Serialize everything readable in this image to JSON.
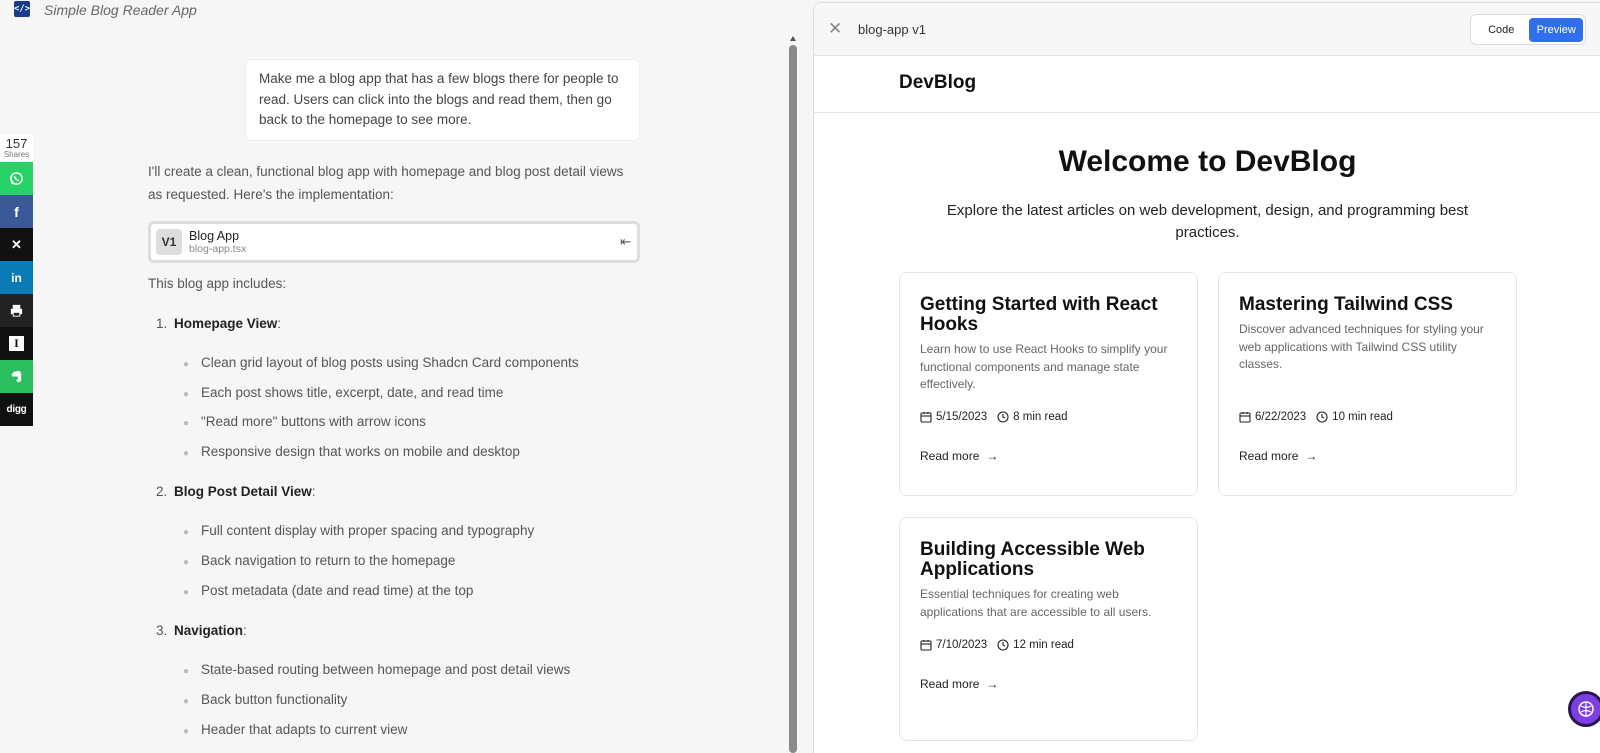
{
  "app": {
    "title": "Simple Blog Reader App",
    "logo_glyph": "</>"
  },
  "share": {
    "count": "157",
    "count_label": "Shares",
    "buttons": [
      {
        "name": "whatsapp",
        "color": "#25d366",
        "glyph": "✆"
      },
      {
        "name": "facebook",
        "color": "#3b5998",
        "glyph": "f"
      },
      {
        "name": "x",
        "color": "#111111",
        "glyph": "𝕏"
      },
      {
        "name": "linkedin",
        "color": "#0a7bb5",
        "glyph": "in"
      },
      {
        "name": "print",
        "color": "#222222",
        "glyph": "⎙"
      },
      {
        "name": "instapaper",
        "color": "#111111",
        "glyph": "I"
      },
      {
        "name": "evernote",
        "color": "#2dbe60",
        "glyph": "❦"
      },
      {
        "name": "digg",
        "color": "#111111",
        "glyph": "digg"
      }
    ]
  },
  "chat": {
    "user_message": "Make me a blog app that has a few blogs there for people to read. Users can click into the blogs and read them, then go back to the homepage to see more.",
    "intro": "I'll create a clean, functional blog app with homepage and blog post detail views as requested. Here's the implementation:",
    "artifact": {
      "version": "V1",
      "name": "Blog App",
      "file": "blog-app.tsx"
    },
    "includes_label": "This blog app includes:",
    "sections": [
      {
        "number": "1.",
        "title": "Homepage View",
        "bullets": [
          "Clean grid layout of blog posts using Shadcn Card components",
          "Each post shows title, excerpt, date, and read time",
          "\"Read more\" buttons with arrow icons",
          "Responsive design that works on mobile and desktop"
        ]
      },
      {
        "number": "2.",
        "title": "Blog Post Detail View",
        "bullets": [
          "Full content display with proper spacing and typography",
          "Back navigation to return to the homepage",
          "Post metadata (date and read time) at the top"
        ]
      },
      {
        "number": "3.",
        "title": "Navigation",
        "bullets": [
          "State-based routing between homepage and post detail views",
          "Back button functionality",
          "Header that adapts to current view"
        ]
      }
    ]
  },
  "panel": {
    "title": "blog-app v1",
    "code_label": "Code",
    "preview_label": "Preview",
    "accent": "#2f6fed"
  },
  "preview": {
    "brand": "DevBlog",
    "hero_title": "Welcome to DevBlog",
    "hero_subtitle": "Explore the latest articles on web development, design, and programming best practices.",
    "posts": [
      {
        "title": "Getting Started with React Hooks",
        "excerpt": "Learn how to use React Hooks to simplify your functional components and manage state effectively.",
        "date": "5/15/2023",
        "read_time": "8 min read",
        "cta": "Read more"
      },
      {
        "title": "Mastering Tailwind CSS",
        "excerpt": "Discover advanced techniques for styling your web applications with Tailwind CSS utility classes.",
        "date": "6/22/2023",
        "read_time": "10 min read",
        "cta": "Read more"
      },
      {
        "title": "Building Accessible Web Applications",
        "excerpt": "Essential techniques for creating web applications that are accessible to all users.",
        "date": "7/10/2023",
        "read_time": "12 min read",
        "cta": "Read more"
      }
    ]
  }
}
